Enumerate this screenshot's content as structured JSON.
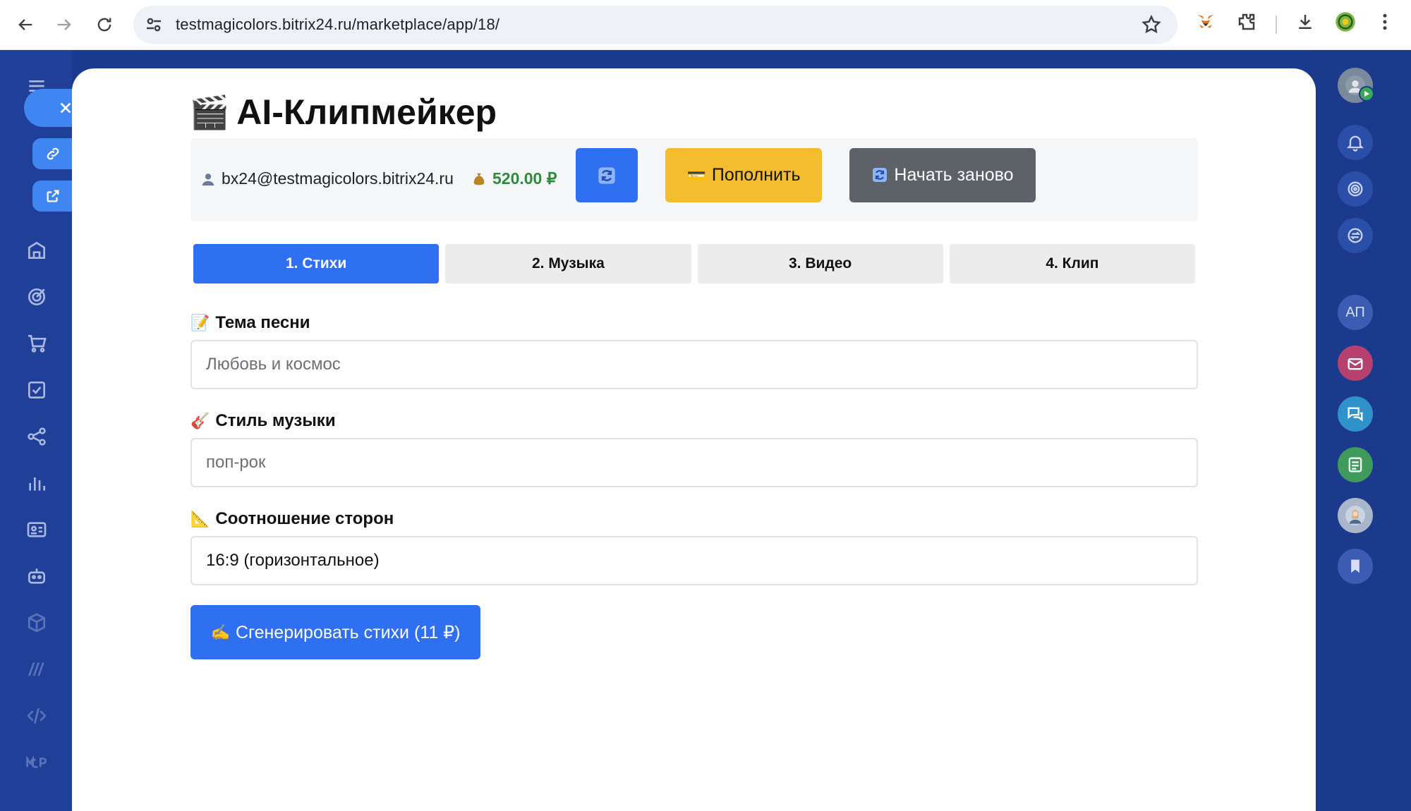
{
  "browser": {
    "url": "testmagicolors.bitrix24.ru/marketplace/app/18/"
  },
  "app": {
    "title_emoji": "🎬",
    "title": "AI-Клипмейкер"
  },
  "status": {
    "user_email": "bx24@testmagicolors.bitrix24.ru",
    "balance": "520.00 ₽",
    "balance_color": "#2e8b3e"
  },
  "actions": {
    "topup_emoji": "💳",
    "topup_label": "Пополнить",
    "restart_label": "Начать заново"
  },
  "tabs": [
    {
      "label": "1. Стихи",
      "active": true
    },
    {
      "label": "2. Музыка",
      "active": false
    },
    {
      "label": "3. Видео",
      "active": false
    },
    {
      "label": "4. Клип",
      "active": false
    }
  ],
  "form": {
    "theme": {
      "emoji": "📝",
      "label": "Тема песни",
      "placeholder": "Любовь и космос"
    },
    "style": {
      "emoji": "🎸",
      "label": "Стиль музыки",
      "placeholder": "поп-рок"
    },
    "aspect": {
      "emoji": "📐",
      "label": "Соотношение сторон",
      "value": "16:9 (горизонтальное)"
    },
    "generate_emoji": "✍️",
    "generate_label": "Сгенерировать стихи (11 ₽)"
  },
  "right_rail": {
    "initials": "АП"
  },
  "colors": {
    "primary": "#2f6ff2",
    "warning": "#f4bd30",
    "secondary": "#5d6268",
    "background_app": "#1b3a8c"
  }
}
